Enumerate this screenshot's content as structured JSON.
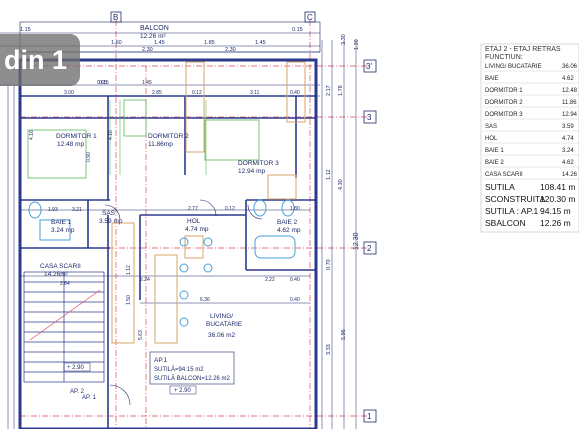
{
  "viewer": {
    "counter_text": "din 1"
  },
  "plan": {
    "balcony_label": "BALCON",
    "balcony_area": "12.26 m²",
    "axis_labels": [
      "B",
      "C",
      "3'",
      "3",
      "2",
      "1"
    ],
    "rooms": {
      "dormitor1": {
        "name": "DORMITOR 1",
        "area": "12.48 mp"
      },
      "dormitor2": {
        "name": "DORMITOR 2",
        "area": "11.86mp"
      },
      "dormitor3": {
        "name": "DORMITOR 3",
        "area": "12.94 mp"
      },
      "sas": {
        "name": "SAS",
        "area": "3.59 mp"
      },
      "hol": {
        "name": "HOL",
        "area": "4.74 mp"
      },
      "baie1": {
        "name": "BAIE 1",
        "area": "3.24 mp"
      },
      "baie2": {
        "name": "BAIE 2",
        "area": "4.62 mp"
      },
      "casa_scarii": {
        "name": "CASA SCARII",
        "area": "14.26m²"
      },
      "living_line1": "LIVING/",
      "living_line2": "BUCATARIE",
      "living_area": "36.06 m2"
    },
    "apartment_box": {
      "title": "AP.1",
      "useful": "SUTILĂ=94.15 m2",
      "useful_balcony": "SUTILĂ BALCON=12.26 m2"
    },
    "level_marks": {
      "main": "+ 2.90",
      "stair": "+ 2.90",
      "ap2": "AP. 2",
      "ap1": "AP. 1"
    },
    "dims_top": [
      "1.15",
      "12.26 m²",
      "1.60",
      "1.45",
      "1.85",
      "1.45",
      "0.15",
      "2.30",
      "2.30",
      "1.30",
      "1.60",
      "1.20"
    ],
    "dims_interior": [
      "3.00",
      "0.15",
      "0.65",
      "1.45",
      "0.12",
      "2.85",
      "0.12",
      "3.11",
      "0.40",
      "0.10",
      "0.12",
      "0.12",
      "0.12",
      "0.12",
      "0.12",
      "0.12",
      "1.93",
      "3.21",
      "0.20",
      "1.20",
      "2.77",
      "0.12",
      "1.80",
      "1.55",
      "2.64",
      "2.24",
      "0.12",
      "2.22",
      "0.40",
      "6.36",
      "0.40",
      "0.12",
      "2.66"
    ],
    "dims_right": [
      "2.17",
      "1.78",
      "4.30",
      "1.12",
      "12.30",
      "0.70",
      "5.96",
      "1.20",
      "3.30",
      "1.20",
      "4.00",
      "1.20",
      "3.33"
    ],
    "dims_left": [
      "4.16",
      "0.90",
      "0.12",
      "4.16",
      "0.60",
      "0.20",
      "0.20",
      "5.63",
      "1.50",
      "1.12",
      "0.80",
      "2.34"
    ]
  },
  "table": {
    "title_line1": "ETAJ 2 - ETAJ RETRAS",
    "title_line2": "FUNCTIUN:",
    "rows": [
      {
        "name": "LIVING/ BUCATARIE",
        "value": "36.06"
      },
      {
        "name": "BAIE",
        "value": "4.62"
      },
      {
        "name": "DORMITOR 1",
        "value": "12.48"
      },
      {
        "name": "DORMITOR 2",
        "value": "11.86"
      },
      {
        "name": "DORMITOR 3",
        "value": "12.94"
      },
      {
        "name": "SAS",
        "value": "3.59"
      },
      {
        "name": "HOL",
        "value": "4.74"
      },
      {
        "name": "BAIE 1",
        "value": "3.24"
      },
      {
        "name": "BAIE 2",
        "value": "4.62"
      },
      {
        "name": "CASA SCARII",
        "value": "14.26"
      }
    ],
    "totals": [
      {
        "name": "SUTILA",
        "value": "108.41 m"
      },
      {
        "name": "SCONSTRUITA",
        "value": "120.30 m"
      },
      {
        "name": "SUTILA : AP.1",
        "value": "94.15 m"
      },
      {
        "name": "SBALCON",
        "value": "12.26 m"
      }
    ]
  },
  "colors": {
    "wall": "#2b3a8c",
    "dimension": "#1f2a6b",
    "axis": "#e0465a",
    "furniture": "#d9a46a",
    "fixture": "#4a9fd9",
    "green_line": "#5cb85c"
  }
}
